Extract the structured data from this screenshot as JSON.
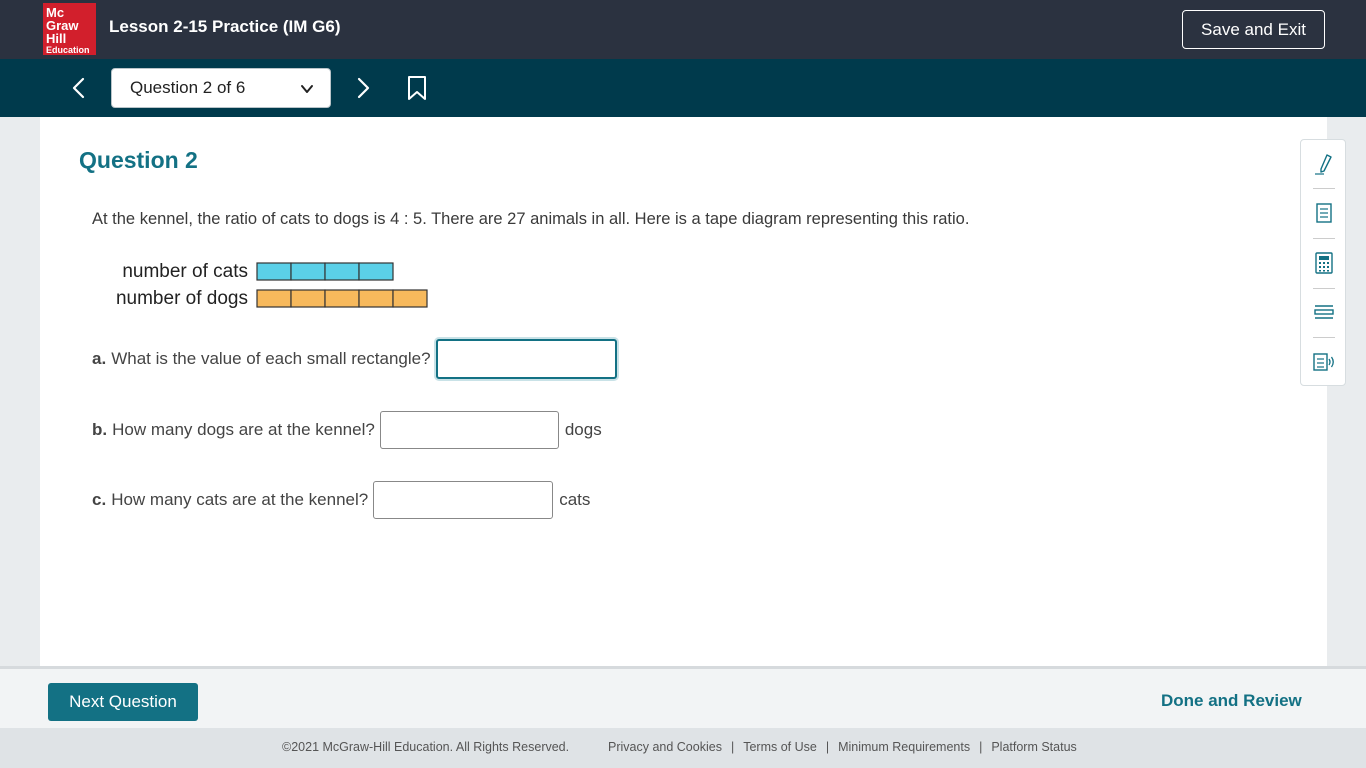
{
  "header": {
    "logo_line1": "Mc",
    "logo_line2": "Graw",
    "logo_line3": "Hill",
    "logo_line4": "Education",
    "lesson_title": "Lesson 2-15 Practice (IM G6)",
    "save_exit_label": "Save and Exit"
  },
  "nav": {
    "question_select": "Question 2 of 6"
  },
  "question": {
    "heading": "Question 2",
    "prompt": "At the kennel, the ratio of cats to dogs is 4 : 5. There are 27 animals in all. Here is a tape diagram representing this ratio.",
    "diagram": {
      "rows": [
        {
          "label": "number of cats",
          "count": 4,
          "color": "#5bd0e8"
        },
        {
          "label": "number of dogs",
          "count": 5,
          "color": "#f7b95c"
        }
      ]
    },
    "parts": [
      {
        "letter": "a.",
        "text": "What is the value of each small rectangle?",
        "value": "",
        "unit": ""
      },
      {
        "letter": "b.",
        "text": "How many dogs are at the kennel?",
        "value": "",
        "unit": "dogs"
      },
      {
        "letter": "c.",
        "text": "How many cats are at the kennel?",
        "value": "",
        "unit": "cats"
      }
    ]
  },
  "tools": [
    "pen-icon",
    "notepad-icon",
    "calculator-icon",
    "line-reader-icon",
    "text-to-speech-icon"
  ],
  "bottom": {
    "next_label": "Next Question",
    "done_label": "Done and Review"
  },
  "footer": {
    "copyright": "©2021 McGraw-Hill Education. All Rights Reserved.",
    "links": [
      "Privacy and Cookies",
      "Terms of Use",
      "Minimum Requirements",
      "Platform Status"
    ]
  },
  "colors": {
    "header_bg": "#2b3240",
    "nav_bg": "#003a4c",
    "accent": "#137184",
    "logo_red": "#d21f2c"
  }
}
